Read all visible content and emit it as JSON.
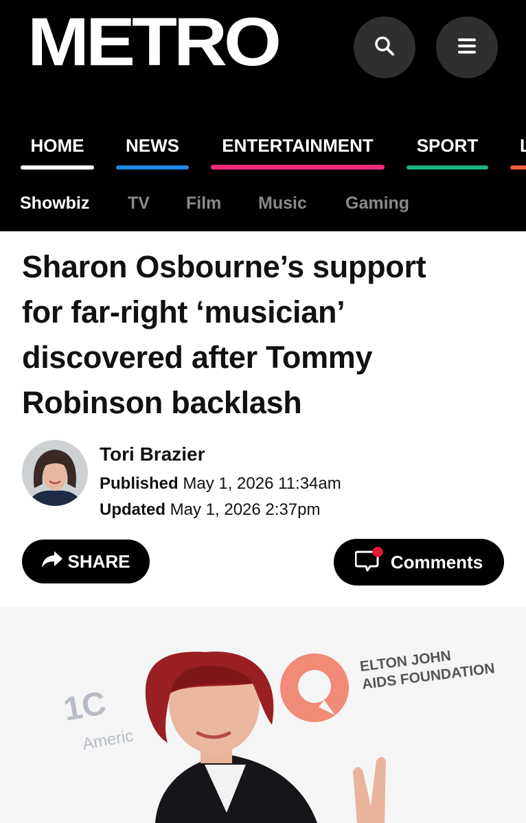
{
  "header": {
    "logo": "METRO",
    "search_icon": "search-icon",
    "menu_icon": "hamburger-menu-icon"
  },
  "nav": {
    "items": [
      {
        "label": "HOME",
        "color": "#ffffff"
      },
      {
        "label": "NEWS",
        "color": "#1e88e5"
      },
      {
        "label": "ENTERTAINMENT",
        "color": "#ee2a7b"
      },
      {
        "label": "SPORT",
        "color": "#19b37a"
      },
      {
        "label": "L",
        "color": "#f05a3c"
      }
    ]
  },
  "subnav": {
    "items": [
      {
        "label": "Showbiz",
        "active": true
      },
      {
        "label": "TV",
        "active": false
      },
      {
        "label": "Film",
        "active": false
      },
      {
        "label": "Music",
        "active": false
      },
      {
        "label": "Gaming",
        "active": false
      }
    ]
  },
  "article": {
    "headline_lines": [
      "Sharon Osbourne’s support",
      "for far-right ‘musician’",
      "discovered after Tommy",
      "Robinson backlash"
    ],
    "author": "Tori Brazier",
    "published_label": "Published",
    "published_value": "May 1, 2026 11:34am",
    "updated_label": "Updated",
    "updated_value": "May 1, 2026 2:37pm"
  },
  "actions": {
    "share_label": "SHARE",
    "comments_label": "Comments",
    "notification_dot_color": "#e8173c"
  },
  "hero_image": {
    "backdrop_text": [
      "ELTON JOHN",
      "AIDS FOUNDATION"
    ],
    "backdrop_text_left": [
      "1C",
      "Americ"
    ]
  }
}
